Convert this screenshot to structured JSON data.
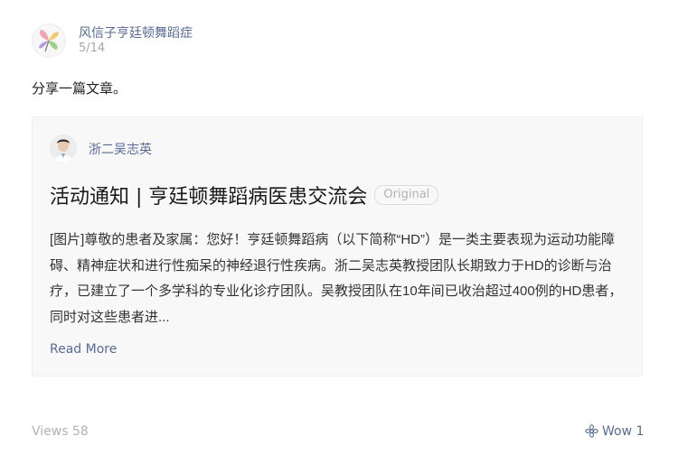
{
  "post": {
    "account_name": "风信子亨廷顿舞蹈症",
    "date": "5/14",
    "text": "分享一篇文章。",
    "views": "Views 58",
    "wow": "Wow 1"
  },
  "article": {
    "author": "浙二吴志英",
    "title": "活动通知 | 亨廷顿舞蹈病医患交流会",
    "original_badge": "Original",
    "excerpt": "[图片]尊敬的患者及家属：您好！亨廷顿舞蹈病（以下简称“HD”）是一类主要表现为运动功能障碍、精神症状和进行性痴呆的神经退行性疾病。浙二吴志英教授团队长期致力于HD的诊断与治疗，已建立了一个多学科的专业化诊疗团队。吴教授团队在10年间已收治超过400例的HD患者，同时对这些患者进...",
    "read_more": "Read More"
  },
  "colors": {
    "link": "#576b95",
    "muted": "#b3b3b3",
    "card_bg": "#f8f8f8"
  },
  "icons": {
    "account_logo": "hyacinth-logo-icon",
    "author_avatar": "author-portrait-icon",
    "wow": "wow-flower-icon"
  }
}
